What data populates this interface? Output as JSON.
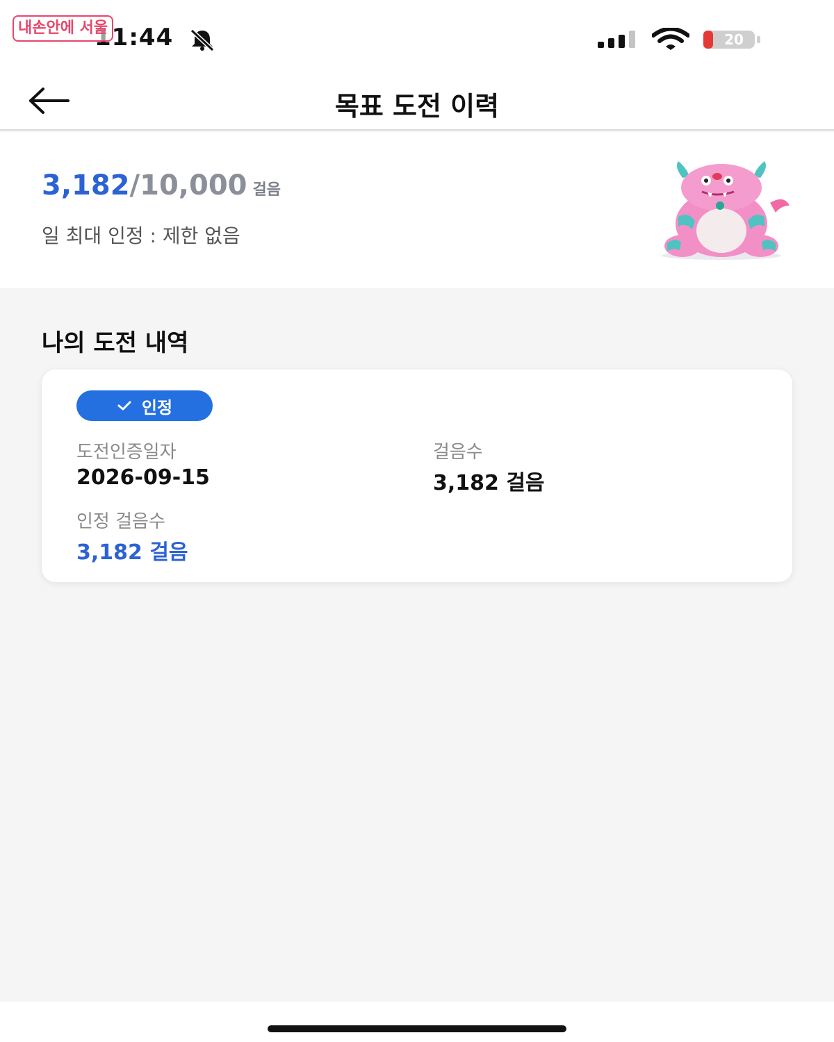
{
  "watermark": "내손안에 서울",
  "status_bar": {
    "time": "11:44",
    "battery_level": "20",
    "icons": [
      "bell-slash-icon",
      "cellular-signal-icon",
      "wifi-icon",
      "battery-icon"
    ]
  },
  "nav": {
    "back_icon": "arrow-left-icon",
    "title": "목표 도전 이력"
  },
  "summary": {
    "current_steps": "3,182",
    "goal_steps": "/10,000",
    "unit": "걸음",
    "daily_limit": "일 최대 인정 : 제한 없음",
    "progress_fraction": 0.3182
  },
  "history": {
    "heading": "나의 도전 내역",
    "records": [
      {
        "badge": "인정",
        "date_label": "도전인증일자",
        "date_value": "2026-09-15",
        "steps_label": "걸음수",
        "steps_value": "3,182 걸음",
        "recognized_label": "인정 걸음수",
        "recognized_value": "3,182 걸음"
      }
    ]
  },
  "colors": {
    "accent_blue": "#2c62d4",
    "badge_blue": "#2470e0",
    "battery_red": "#e53935",
    "watermark_pink": "#e8466b"
  }
}
